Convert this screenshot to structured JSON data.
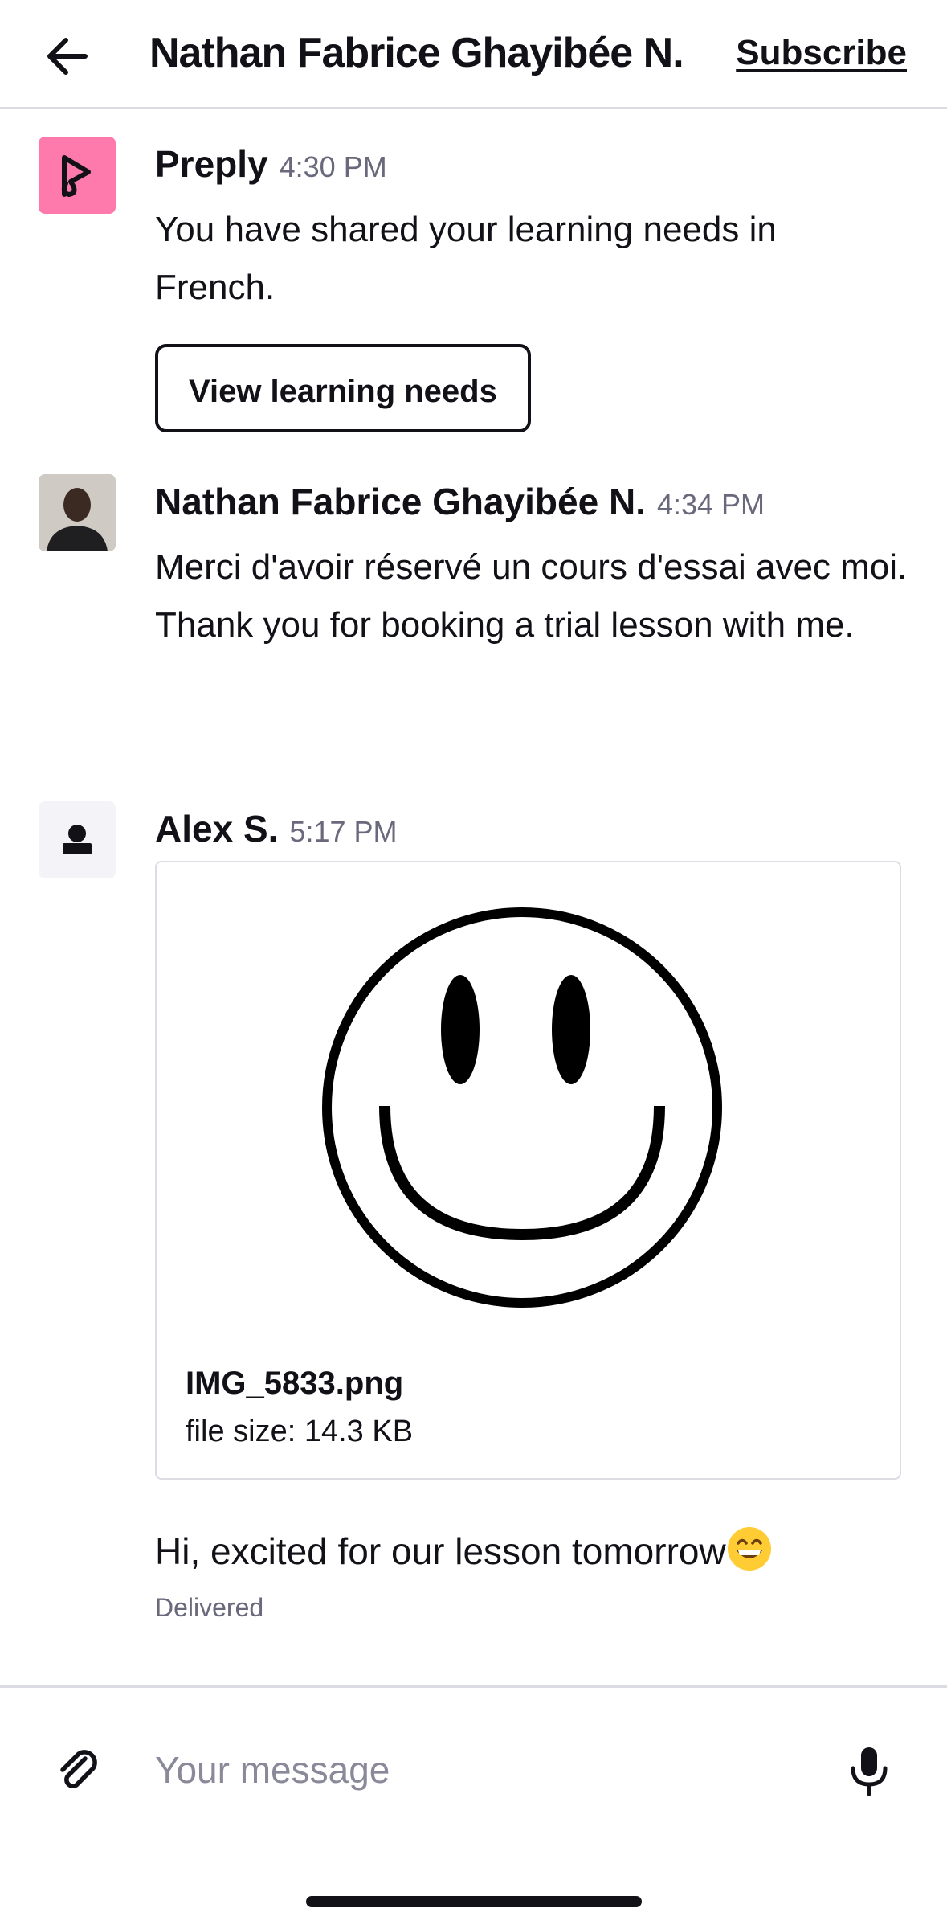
{
  "header": {
    "title": "Nathan Fabrice Ghayibée N.",
    "subscribe_label": "Subscribe",
    "back_icon": "arrow-left-icon"
  },
  "messages": [
    {
      "sender": "Preply",
      "time": "4:30 PM",
      "text": "You have shared your learning needs in French.",
      "button_label": "View learning needs",
      "avatar": "preply-logo-icon"
    },
    {
      "sender": "Nathan Fabrice Ghayibée N.",
      "time": "4:34 PM",
      "lines": [
        "Merci d'avoir réservé un cours d'essai avec moi.",
        "Thank you for booking a trial lesson with me."
      ],
      "avatar": "tutor-photo"
    },
    {
      "sender": "Alex S.",
      "time": "5:17 PM",
      "avatar": "user-placeholder-icon",
      "attachment": {
        "file_name": "IMG_5833.png",
        "file_size": "file size: 14.3 KB",
        "preview": "smiley-face-image"
      },
      "followup_text": "Hi, excited for our lesson tomorrow",
      "followup_emoji": "grinning-face-emoji",
      "status": "Delivered"
    }
  ],
  "composer": {
    "placeholder": "Your message",
    "attach_icon": "paperclip-icon",
    "mic_icon": "microphone-icon"
  },
  "colors": {
    "brand_pink": "#ff7aac",
    "text_primary": "#121117",
    "text_secondary": "#6a697c",
    "border": "#dcdce5"
  }
}
